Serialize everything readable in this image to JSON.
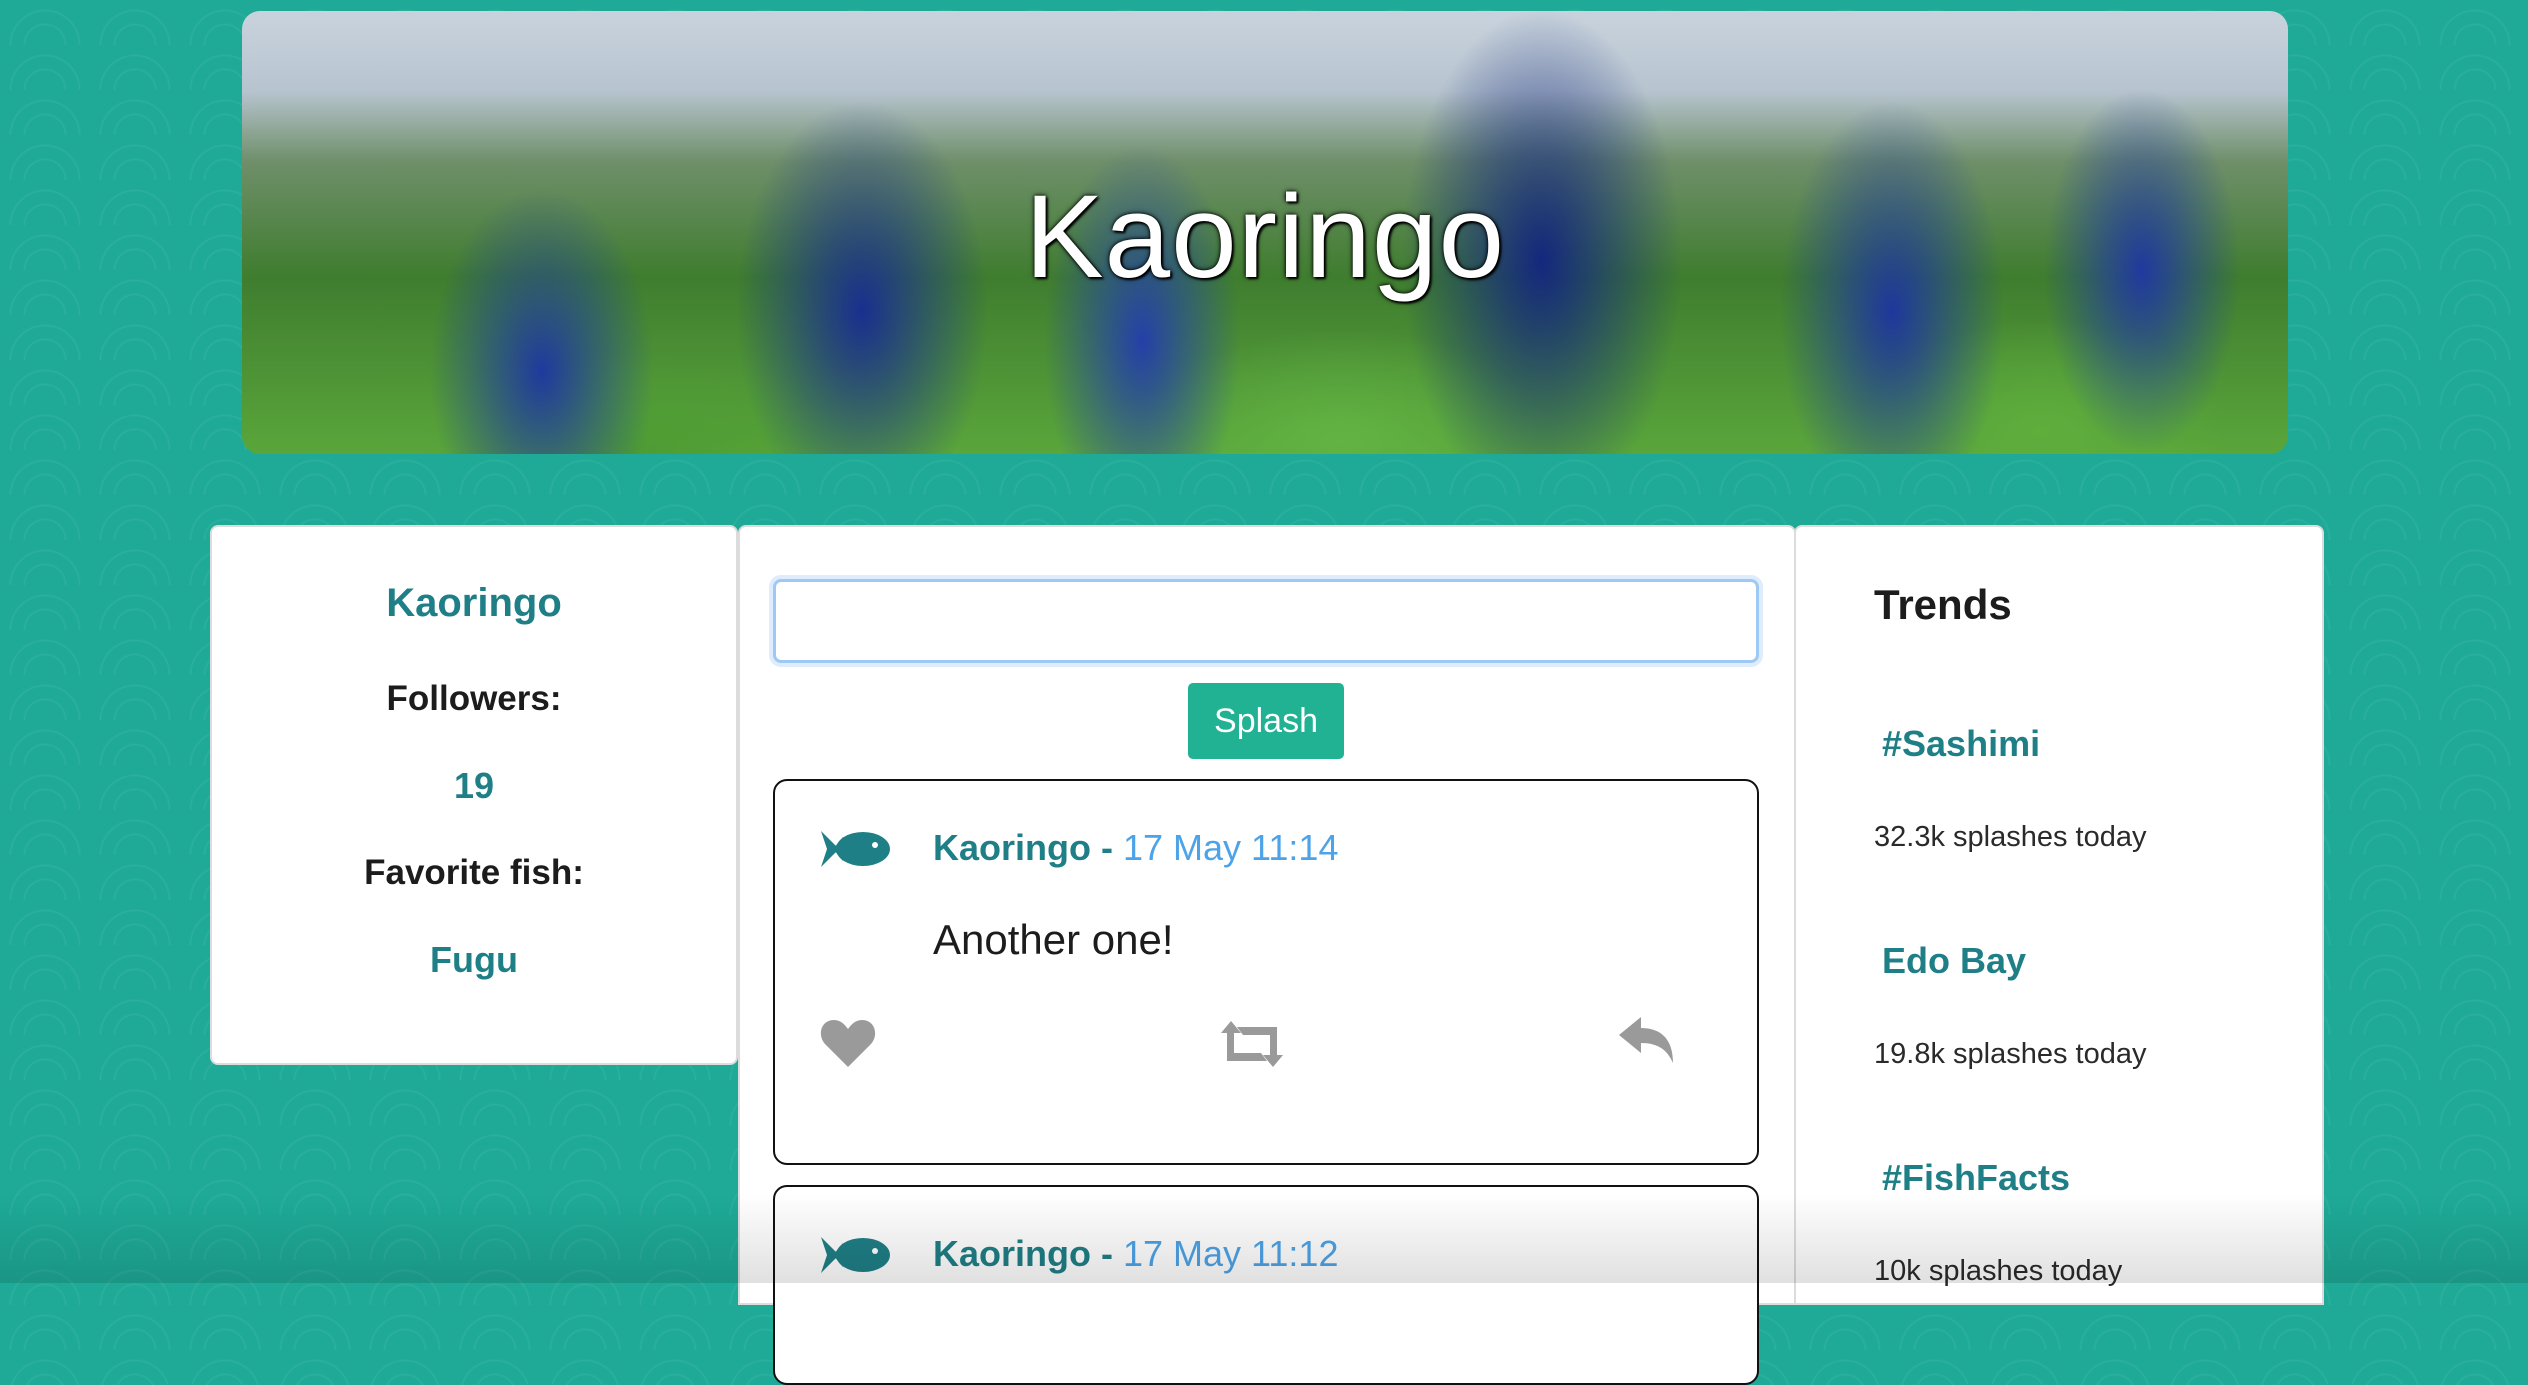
{
  "banner": {
    "title": "Kaoringo"
  },
  "profile": {
    "name": "Kaoringo",
    "followers_label": "Followers:",
    "followers_count": "19",
    "favorite_fish_label": "Favorite fish:",
    "favorite_fish": "Fugu"
  },
  "composer": {
    "input_value": "",
    "button_label": "Splash"
  },
  "posts": [
    {
      "author": "Kaoringo",
      "separator": " - ",
      "time": "17 May 11:14",
      "text": "Another one!"
    },
    {
      "author": "Kaoringo",
      "separator": " - ",
      "time": "17 May 11:12",
      "text": ""
    }
  ],
  "trends": {
    "title": "Trends",
    "items": [
      {
        "name": "#Sashimi",
        "count": "32.3k splashes today"
      },
      {
        "name": "Edo Bay",
        "count": "19.8k splashes today"
      },
      {
        "name": "#FishFacts",
        "count": "10k splashes today"
      }
    ]
  },
  "icons": {
    "fish": "fish-icon",
    "like": "heart-icon",
    "resplash": "retweet-icon",
    "reply": "reply-icon"
  },
  "colors": {
    "background": "#1eaa97",
    "accent": "#1f7f86",
    "button": "#20b293",
    "timestamp": "#4da3e8",
    "action_icons": "#9a9a9a"
  }
}
